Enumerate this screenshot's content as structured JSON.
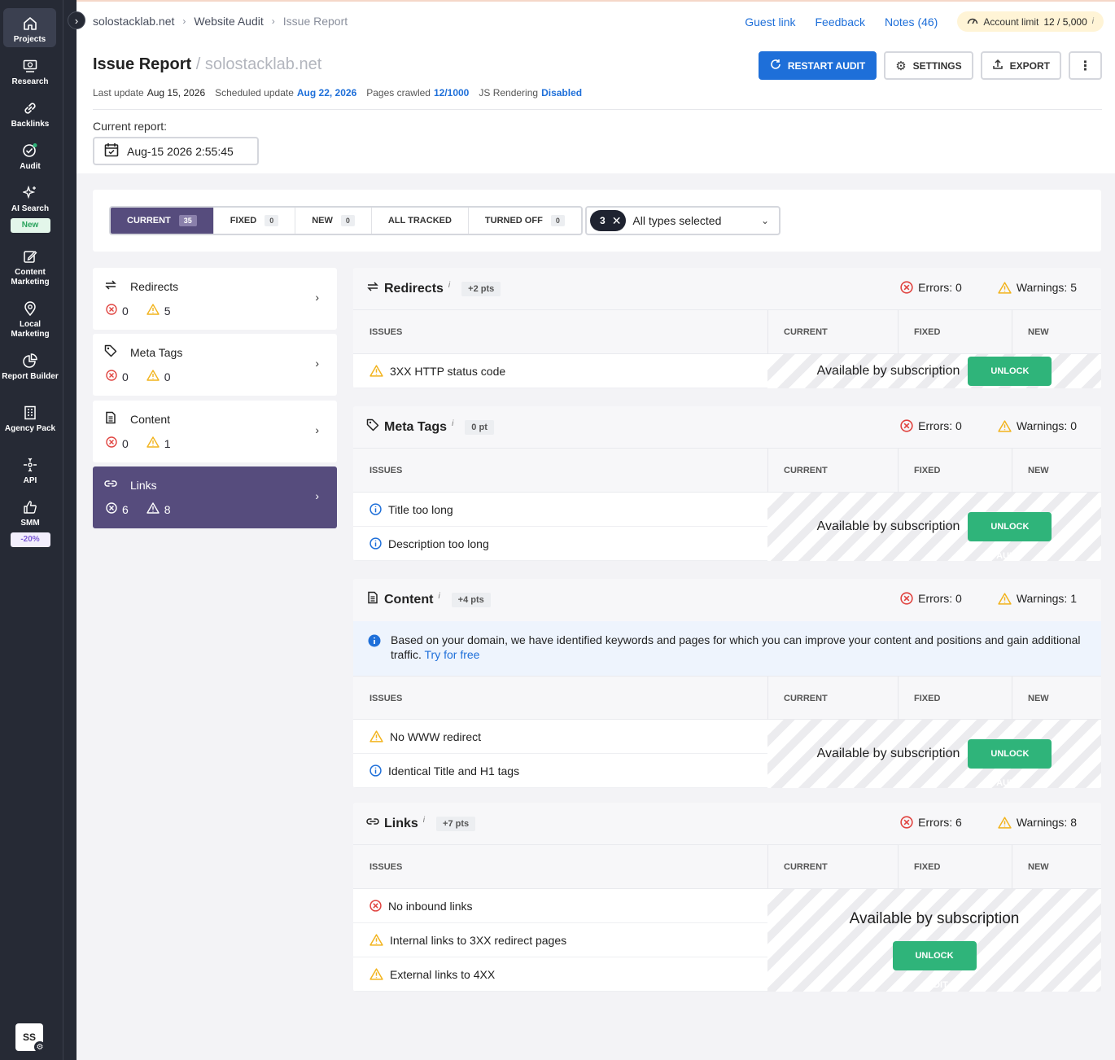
{
  "sidebar": {
    "items": [
      {
        "label": "Projects",
        "icon": "home-icon"
      },
      {
        "label": "Research",
        "icon": "research-icon"
      },
      {
        "label": "Backlinks",
        "icon": "link-icon"
      },
      {
        "label": "Audit",
        "icon": "audit-icon"
      },
      {
        "label": "AI Search",
        "icon": "sparkle-icon",
        "badge": "New"
      },
      {
        "label": "Content Marketing",
        "icon": "edit-icon"
      },
      {
        "label": "Local Marketing",
        "icon": "location-pin-icon"
      },
      {
        "label": "Report Builder",
        "icon": "pie-chart-icon"
      },
      {
        "label": "Agency Pack",
        "icon": "building-icon"
      },
      {
        "label": "API",
        "icon": "api-icon"
      },
      {
        "label": "SMM",
        "icon": "thumbs-up-icon",
        "badge": "-20%"
      }
    ],
    "avatar": "SS"
  },
  "breadcrumb": [
    "solostacklab.net",
    "Website Audit",
    "Issue Report"
  ],
  "top_links": {
    "guest": "Guest link",
    "feedback": "Feedback",
    "notes": "Notes (46)"
  },
  "account": {
    "label": "Account limit",
    "value": "12 / 5,000",
    "info": "i"
  },
  "page": {
    "title": "Issue Report",
    "domain": "/ solostacklab.net"
  },
  "meta": {
    "last_update_label": "Last update",
    "last_update": "Aug 15, 2026",
    "scheduled_label": "Scheduled update",
    "scheduled": "Aug 22, 2026",
    "pages_label": "Pages crawled",
    "pages": "12/1000",
    "js_label": "JS Rendering",
    "js": "Disabled"
  },
  "buttons": {
    "restart": "RESTART AUDIT",
    "settings": "SETTINGS",
    "export": "EXPORT"
  },
  "report": {
    "label": "Current report:",
    "date": "Aug-15 2026 2:55:45"
  },
  "tabs": [
    {
      "label": "CURRENT",
      "count": "35"
    },
    {
      "label": "FIXED",
      "count": "0"
    },
    {
      "label": "NEW",
      "count": "0"
    },
    {
      "label": "ALL TRACKED",
      "count": ""
    },
    {
      "label": "TURNED OFF",
      "count": "0"
    }
  ],
  "types_filter": {
    "count": "3",
    "label": "All types selected"
  },
  "categories": [
    {
      "name": "Redirects",
      "errors": "0",
      "warnings": "5"
    },
    {
      "name": "Meta Tags",
      "errors": "0",
      "warnings": "0"
    },
    {
      "name": "Content",
      "errors": "0",
      "warnings": "1"
    },
    {
      "name": "Links",
      "errors": "6",
      "warnings": "8"
    }
  ],
  "table_headers": {
    "issues": "ISSUES",
    "current": "CURRENT",
    "fixed": "FIXED",
    "new": "NEW"
  },
  "locked": {
    "text": "Available by subscription",
    "button": "UNLOCK AUDIT"
  },
  "sections": {
    "redirects": {
      "title": "Redirects",
      "pts": "+2 pts",
      "errors": "Errors: 0",
      "warnings": "Warnings: 5",
      "issues": [
        "3XX HTTP status code"
      ]
    },
    "meta": {
      "title": "Meta Tags",
      "pts": "0 pt",
      "errors": "Errors: 0",
      "warnings": "Warnings: 0",
      "issues": [
        "Title too long",
        "Description too long"
      ]
    },
    "content": {
      "title": "Content",
      "pts": "+4 pts",
      "errors": "Errors: 0",
      "warnings": "Warnings: 1",
      "banner": "Based on your domain, we have identified keywords and pages for which you can improve your content and positions and gain additional traffic.",
      "banner_link": "Try for free",
      "issues": [
        "No WWW redirect",
        "Identical Title and H1 tags"
      ]
    },
    "links": {
      "title": "Links",
      "pts": "+7 pts",
      "errors": "Errors: 6",
      "warnings": "Warnings: 8",
      "issues": [
        "No inbound links",
        "Internal links to 3XX redirect pages",
        "External links to 4XX"
      ]
    }
  },
  "colors": {
    "accent": "#1e6fd9",
    "selected": "#564c7d",
    "error": "#e0433f",
    "warning": "#f2b31c",
    "info": "#1e6fd9",
    "unlock": "#2fb47a"
  }
}
